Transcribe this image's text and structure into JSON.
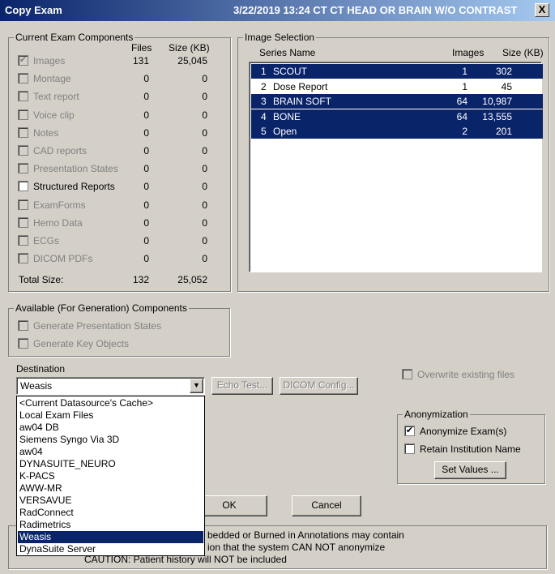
{
  "window": {
    "title": "Copy Exam",
    "exam_info": "3/22/2019 13:24  CT CT HEAD OR BRAIN W/O CONTRAST",
    "close_label": "X"
  },
  "components": {
    "group_title": "Current Exam Components",
    "col_files": "Files",
    "col_size": "Size (KB)",
    "items": [
      {
        "label": "Images",
        "files": "131",
        "size": "25,045",
        "checked": true,
        "enabled": false
      },
      {
        "label": "Montage",
        "files": "0",
        "size": "0",
        "checked": false,
        "enabled": false
      },
      {
        "label": "Text report",
        "files": "0",
        "size": "0",
        "checked": false,
        "enabled": false
      },
      {
        "label": "Voice clip",
        "files": "0",
        "size": "0",
        "checked": false,
        "enabled": false
      },
      {
        "label": "Notes",
        "files": "0",
        "size": "0",
        "checked": false,
        "enabled": false
      },
      {
        "label": "CAD reports",
        "files": "0",
        "size": "0",
        "checked": false,
        "enabled": false
      },
      {
        "label": "Presentation States",
        "files": "0",
        "size": "0",
        "checked": false,
        "enabled": false
      },
      {
        "label": "Structured Reports",
        "files": "0",
        "size": "0",
        "checked": false,
        "enabled": true
      },
      {
        "label": "ExamForms",
        "files": "0",
        "size": "0",
        "checked": false,
        "enabled": false
      },
      {
        "label": "Hemo Data",
        "files": "0",
        "size": "0",
        "checked": false,
        "enabled": false
      },
      {
        "label": "ECGs",
        "files": "0",
        "size": "0",
        "checked": false,
        "enabled": false
      },
      {
        "label": "DICOM PDFs",
        "files": "0",
        "size": "0",
        "checked": false,
        "enabled": false
      }
    ],
    "total_label": "Total Size:",
    "total_files": "132",
    "total_size": "25,052"
  },
  "image_selection": {
    "group_title": "Image Selection",
    "col_series": "Series Name",
    "col_images": "Images",
    "col_size": "Size (KB)",
    "series": [
      {
        "num": "1",
        "name": "SCOUT",
        "images": "1",
        "size": "302",
        "selected": true
      },
      {
        "num": "2",
        "name": "Dose Report",
        "images": "1",
        "size": "45",
        "selected": false
      },
      {
        "num": "3",
        "name": "BRAIN SOFT",
        "images": "64",
        "size": "10,987",
        "selected": true
      },
      {
        "num": "4",
        "name": "BONE",
        "images": "64",
        "size": "13,555",
        "selected": true
      },
      {
        "num": "5",
        "name": "Open",
        "images": "2",
        "size": "201",
        "selected": true
      }
    ]
  },
  "available": {
    "group_title": "Available (For Generation) Components",
    "items": [
      "Generate Presentation States",
      "Generate Key Objects"
    ]
  },
  "destination": {
    "label": "Destination",
    "value": "Weasis",
    "echo_label": "Echo Test...",
    "dicom_config_label": "DICOM Config...",
    "options": [
      "<Current Datasource's Cache>",
      "Local Exam Files",
      "aw04 DB",
      "Siemens Syngo Via 3D",
      "aw04",
      "DYNASUITE_NEURO",
      "K-PACS",
      "AWW-MR",
      "VERSAVUE",
      "RadConnect",
      "Radimetrics",
      "Weasis",
      "DynaSuite Server"
    ],
    "selected_option": "Weasis"
  },
  "overwrite_label": "Overwrite existing files",
  "anonymization": {
    "group_title": "Anonymization",
    "anonymize_label": "Anonymize Exam(s)",
    "anonymize_checked": true,
    "retain_label": "Retain Institution Name",
    "retain_checked": false,
    "set_values_label": "Set Values ..."
  },
  "buttons": {
    "ok": "OK",
    "cancel": "Cancel"
  },
  "caution": {
    "line1": "bedded or Burned in Annotations may contain",
    "line2": "ion that the system CAN NOT anonymize",
    "line3": "CAUTION:  Patient history will NOT be included"
  },
  "colors": {
    "selection": "#0a246a",
    "face": "#d4d0c8",
    "disabled_text": "#808080"
  }
}
